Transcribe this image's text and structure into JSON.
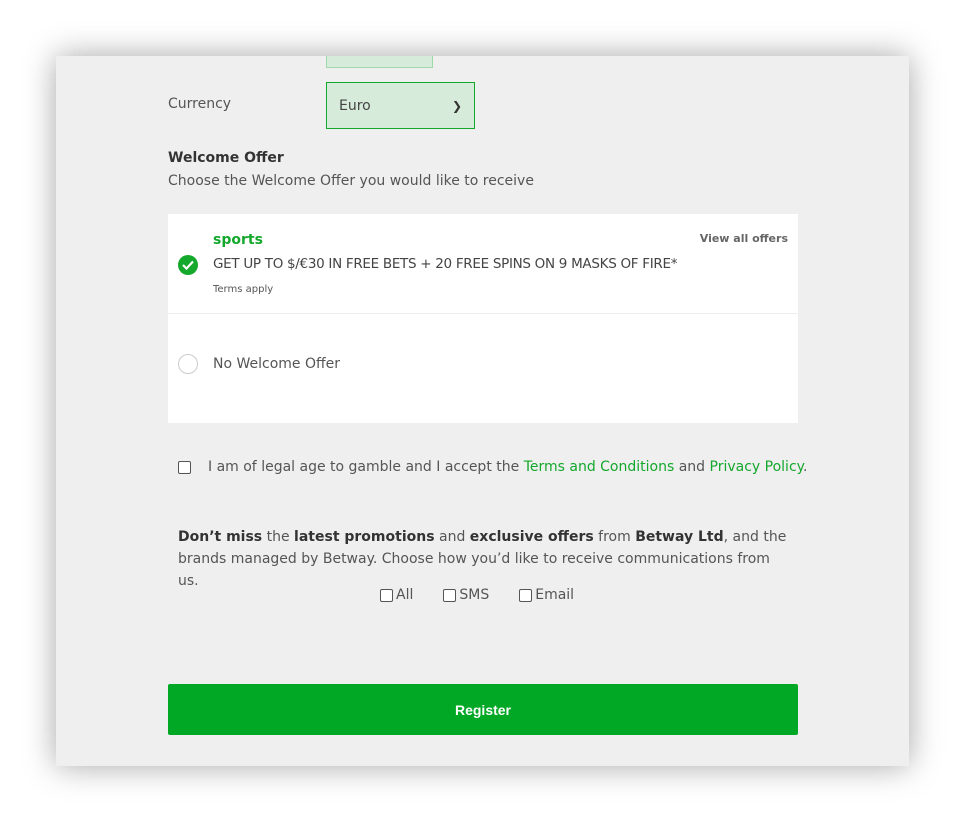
{
  "currency": {
    "label": "Currency",
    "selected": "Euro"
  },
  "welcome_offer": {
    "title": "Welcome Offer",
    "subtitle": "Choose the Welcome Offer you would like to receive",
    "view_all": "View all offers",
    "offers": [
      {
        "name": "sports",
        "description": "GET UP TO $/€30 IN FREE BETS + 20 FREE SPINS ON 9 MASKS OF FIRE*",
        "terms": "Terms apply",
        "selected": true
      },
      {
        "name": "No Welcome Offer",
        "selected": false
      }
    ]
  },
  "legal": {
    "prefix": "I am of legal age to gamble and I accept the",
    "terms_link": "Terms and Conditions",
    "and": "and",
    "privacy_link": "Privacy Policy",
    "suffix": ".",
    "checked": false
  },
  "promo": {
    "p1": "Don’t miss",
    "p2": " the ",
    "p3": "latest promotions",
    "p4": " and ",
    "p5": "exclusive offers",
    "p6": " from ",
    "p7": "Betway Ltd",
    "p8": ", and the brands managed by Betway. Choose how you’d like to receive communications from us.",
    "options": [
      "All",
      "SMS",
      "Email"
    ]
  },
  "register_label": "Register",
  "colors": {
    "accent": "#00a826",
    "background": "#efefef"
  }
}
